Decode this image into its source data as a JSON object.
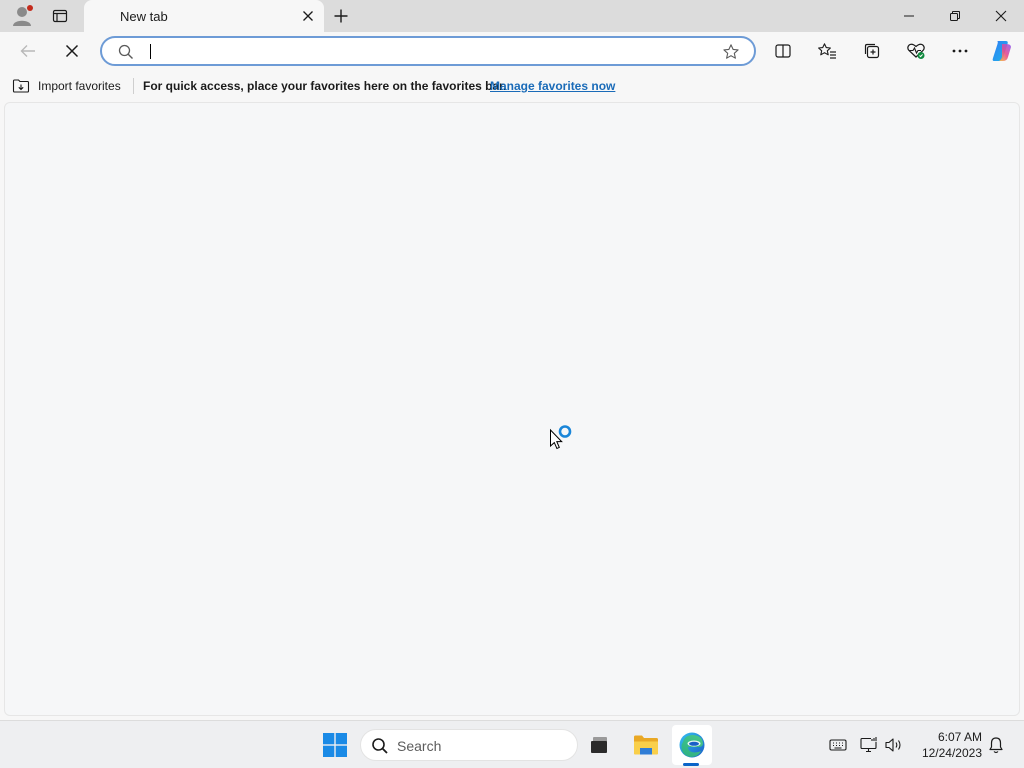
{
  "browser": {
    "tab": {
      "title": "New tab"
    },
    "omnibox": {
      "value": "",
      "placeholder": ""
    },
    "favorites_bar": {
      "import_label": "Import favorites",
      "message": "For quick access, place your favorites here on the favorites bar.",
      "link_label": "Manage favorites now"
    }
  },
  "icons": {
    "tabstrip": [
      "profile-icon",
      "workspaces-icon",
      "close-icon",
      "plus-icon"
    ],
    "window": [
      "minimize-icon",
      "restore-icon",
      "close-icon"
    ],
    "toolbar": [
      "back-arrow-icon",
      "stop-icon",
      "search-icon",
      "star-icon",
      "split-screen-icon",
      "favorites-icon",
      "collections-icon",
      "browser-essentials-icon",
      "more-icon",
      "copilot-icon"
    ],
    "taskbar": [
      "windows-logo-icon",
      "search-icon",
      "task-view-icon",
      "file-explorer-icon",
      "edge-icon",
      "keyboard-icon",
      "network-icon",
      "volume-icon",
      "bell-icon"
    ]
  },
  "taskbar": {
    "search_label": "Search",
    "clock": {
      "time": "6:07 AM",
      "date": "12/24/2023"
    }
  },
  "colors": {
    "accent": "#0a64c8",
    "link": "#1a6bb8",
    "notification_dot": "#c42b1c",
    "omnibox_focus_border": "#6d9bd6"
  }
}
